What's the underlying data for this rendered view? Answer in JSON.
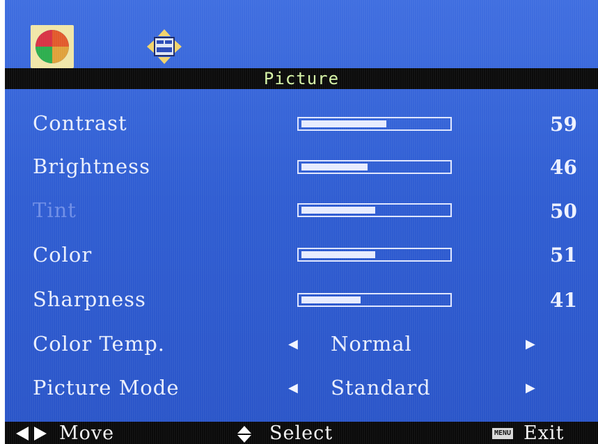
{
  "tabs": [
    {
      "icon": "color-wheel-icon"
    },
    {
      "icon": "screen-position-icon"
    }
  ],
  "title": "Picture",
  "sliders": [
    {
      "label": "Contrast",
      "value": "59",
      "level": 0.59
    },
    {
      "label": "Brightness",
      "value": "46",
      "level": 0.46
    },
    {
      "label": "Tint",
      "value": "50",
      "level": 0.5
    },
    {
      "label": "Color",
      "value": "51",
      "level": 0.51
    },
    {
      "label": "Sharpness",
      "value": "41",
      "level": 0.41
    }
  ],
  "options": [
    {
      "label": "Color Temp.",
      "value": "Normal"
    },
    {
      "label": "Picture Mode",
      "value": "Standard"
    }
  ],
  "footer": {
    "move": "Move",
    "select": "Select",
    "menu_key": "MENU",
    "exit": "Exit"
  }
}
